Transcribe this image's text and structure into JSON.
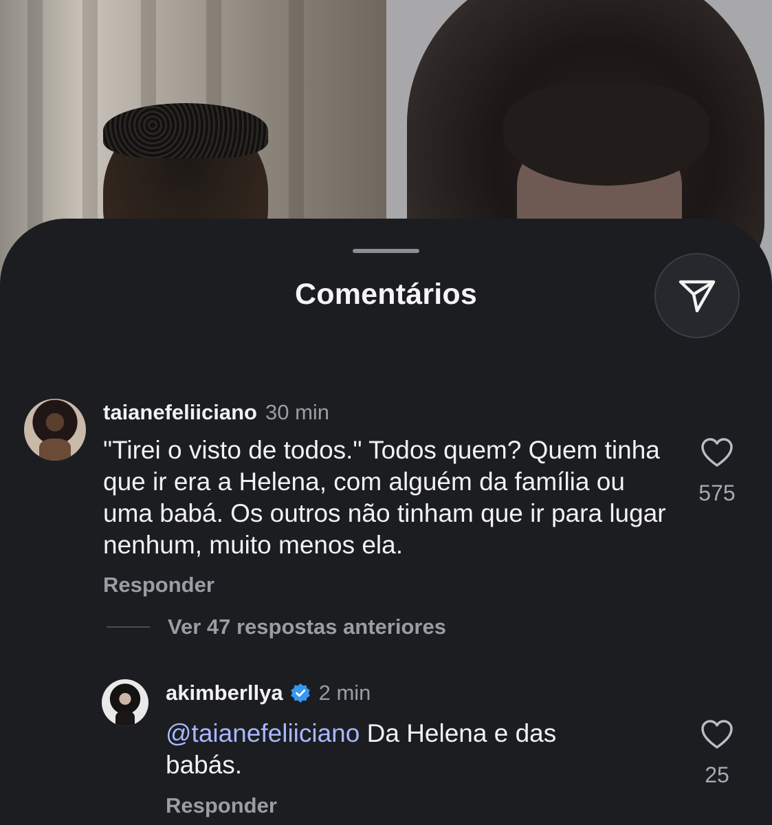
{
  "sheet": {
    "title": "Comentários"
  },
  "icons": {
    "share": "send-icon",
    "like": "heart-icon",
    "verified": "verified-badge-icon"
  },
  "colors": {
    "sheet_bg": "#1b1d21",
    "mention": "#a9b7ff",
    "verified": "#3897f0",
    "muted": "#9a9da3"
  },
  "comments": [
    {
      "username": "taianefeliiciano",
      "time": "30 min",
      "text": "\"Tirei o visto de todos.\" Todos quem? Quem tinha que ir era a Helena, com alguém da família ou uma babá. Os outros não tinham que ir para lugar nenhum, muito menos ela.",
      "reply_label": "Responder",
      "likes": "575",
      "verified": false
    }
  ],
  "replies_toggle": {
    "label": "Ver 47 respostas anteriores"
  },
  "replies": [
    {
      "username": "akimberllya",
      "time": "2 min",
      "mention": "@taianefeliiciano",
      "text": " Da Helena e das babás.",
      "reply_label": "Responder",
      "likes": "25",
      "verified": true
    }
  ]
}
